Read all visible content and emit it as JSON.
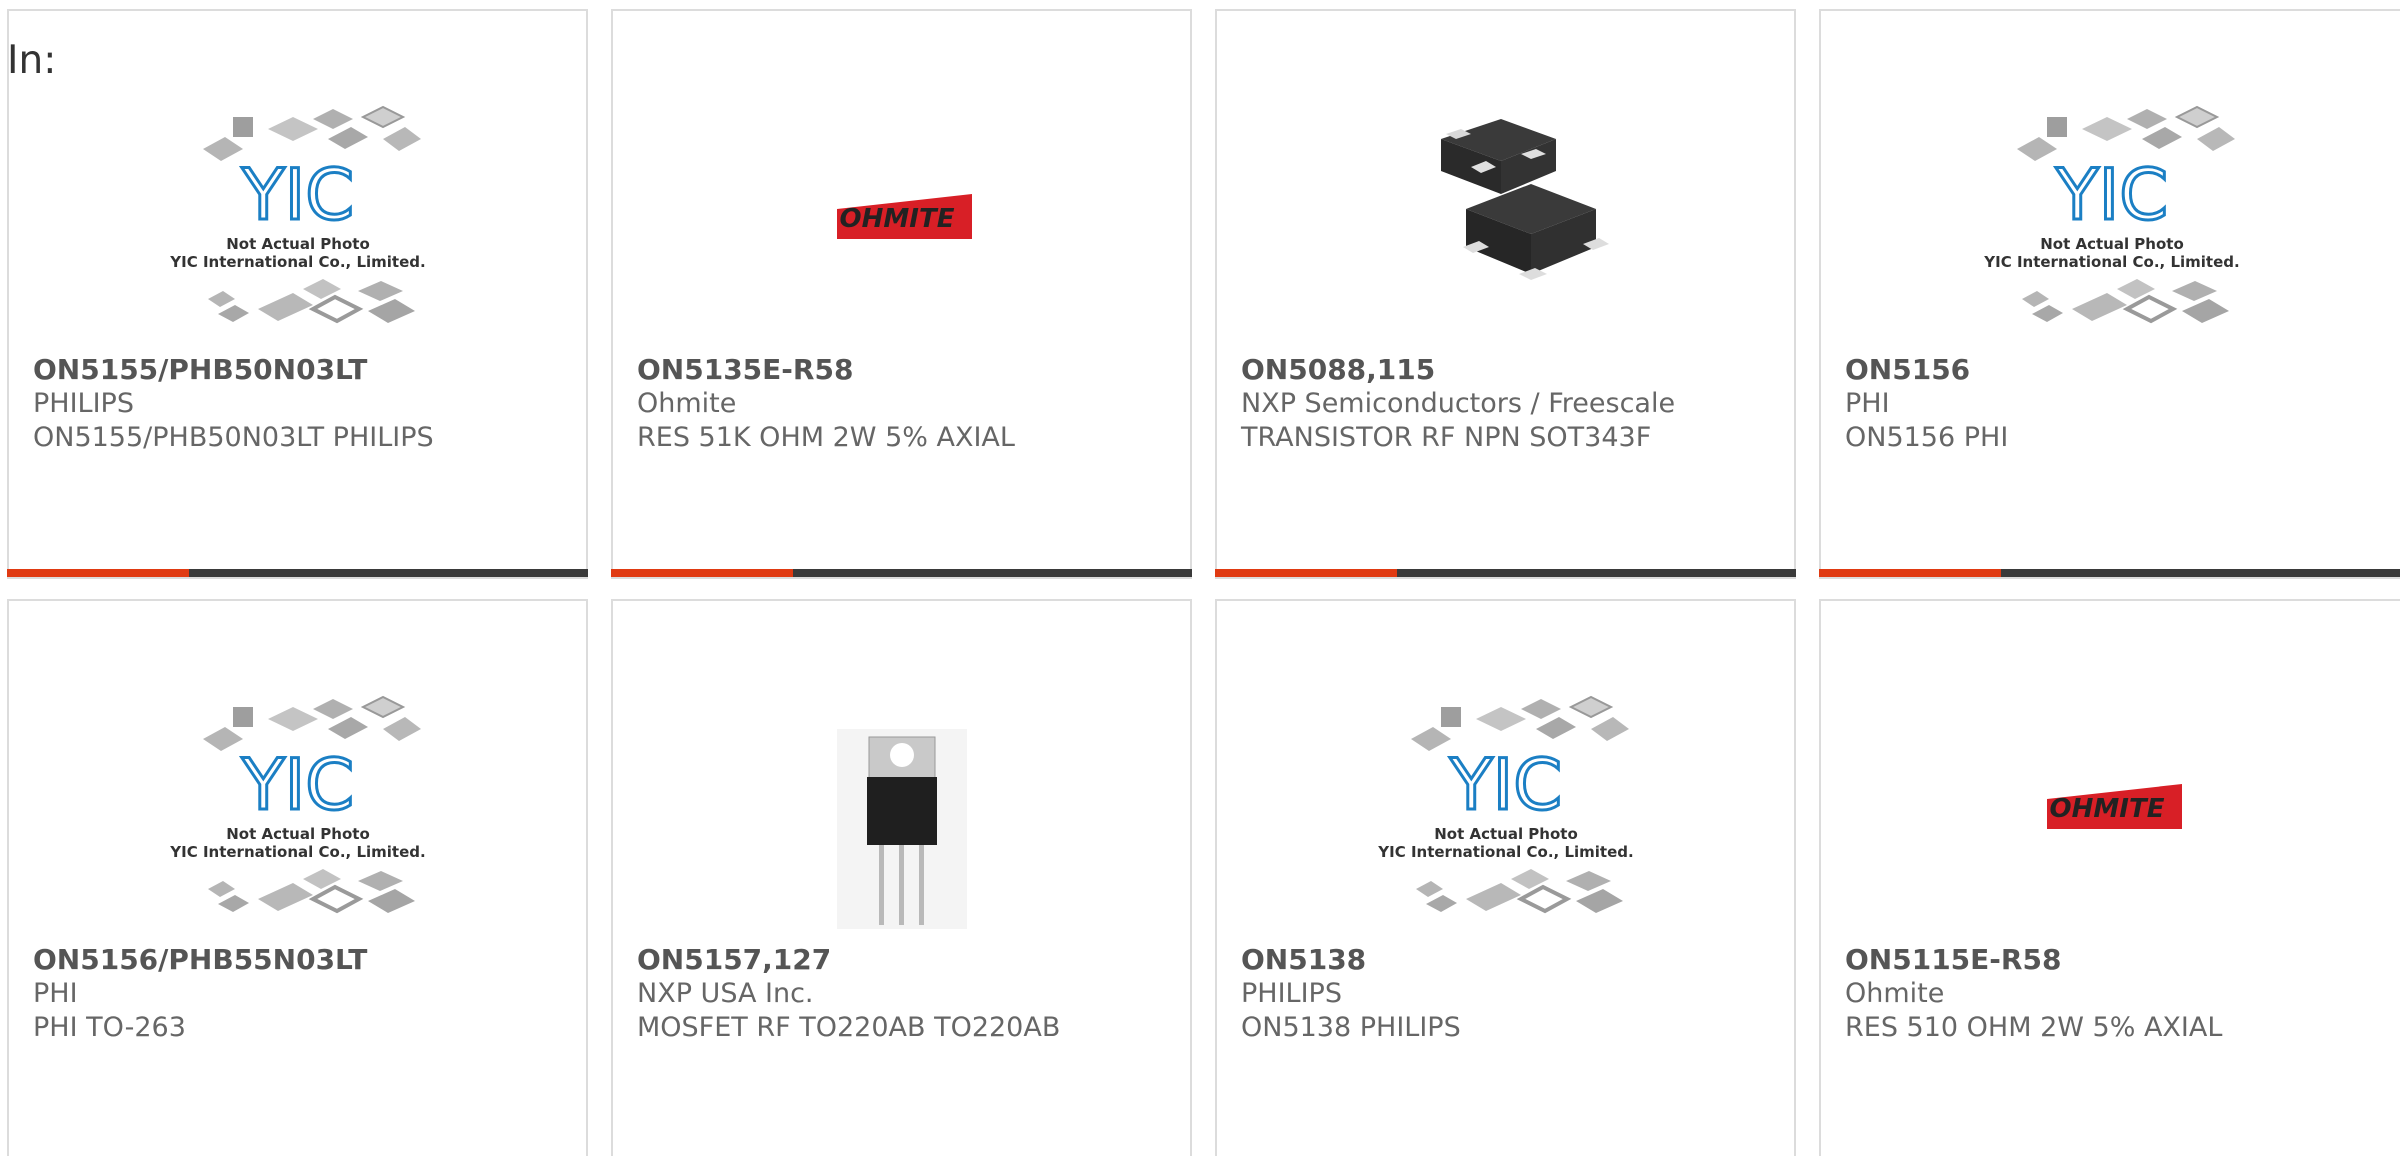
{
  "page": {
    "in_label": "In:"
  },
  "placeholder_image": {
    "logo_text": "YIC",
    "line1": "Not Actual Photo",
    "line2": "YIC International Co., Limited."
  },
  "ohmite_logo_text": "OHMITE",
  "colors": {
    "accent": "#e03a12",
    "bar": "#3a3a3a",
    "ohmite_red": "#d81f26",
    "yic_blue": "#1b7fc4"
  },
  "products": [
    {
      "part_number": "ON5155/PHB50N03LT",
      "manufacturer": "PHILIPS",
      "description": "ON5155/PHB50N03LT PHILIPS",
      "image": "placeholder"
    },
    {
      "part_number": "ON5135E-R58",
      "manufacturer": "Ohmite",
      "description": "RES 51K OHM 2W 5% AXIAL",
      "image": "ohmite-logo"
    },
    {
      "part_number": "ON5088,115",
      "manufacturer": "NXP Semiconductors / Freescale",
      "description": "TRANSISTOR RF NPN SOT343F",
      "image": "sot343-package"
    },
    {
      "part_number": "ON5156",
      "manufacturer": "PHI",
      "description": "ON5156 PHI",
      "image": "placeholder"
    },
    {
      "part_number": "ON5156/PHB55N03LT",
      "manufacturer": "PHI",
      "description": "PHI TO-263",
      "image": "placeholder"
    },
    {
      "part_number": "ON5157,127",
      "manufacturer": "NXP USA Inc.",
      "description": "MOSFET RF TO220AB TO220AB",
      "image": "to220-package"
    },
    {
      "part_number": "ON5138",
      "manufacturer": "PHILIPS",
      "description": "ON5138 PHILIPS",
      "image": "placeholder"
    },
    {
      "part_number": "ON5115E-R58",
      "manufacturer": "Ohmite",
      "description": "RES 510 OHM 2W 5% AXIAL",
      "image": "ohmite-logo"
    }
  ]
}
